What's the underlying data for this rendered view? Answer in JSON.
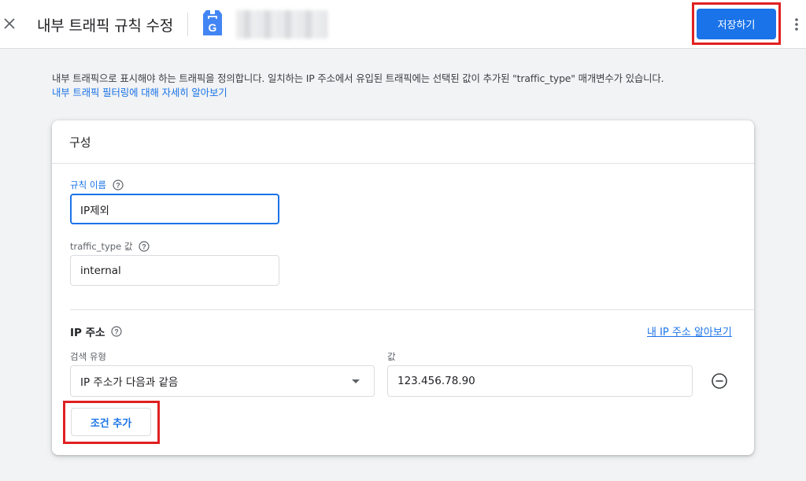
{
  "header": {
    "title": "내부 트래픽 규칙 수정",
    "property_name_obscured": "",
    "save_label": "저장하기"
  },
  "description": {
    "text": "내부 트래픽으로 표시해야 하는 트래픽을 정의합니다. 일치하는 IP 주소에서 유입된 트래픽에는 선택된 값이 추가된 \"traffic_type\" 매개변수가 있습니다.",
    "link": "내부 트래픽 필터링에 대해 자세히 알아보기"
  },
  "config": {
    "title": "구성",
    "rule_name": {
      "label": "규칙 이름",
      "value": "IP제외"
    },
    "traffic_type": {
      "label": "traffic_type 값",
      "value": "internal"
    },
    "ip": {
      "title": "IP 주소",
      "find_ip_link": "내 IP 주소 알아보기",
      "match_type_label": "검색 유형",
      "match_type_value": "IP 주소가 다음과 같음",
      "value_label": "값",
      "value": "123.456.78.90",
      "add_condition_label": "조건 추가"
    }
  },
  "colors": {
    "accent": "#1a73e8",
    "highlight": "#e02020"
  },
  "icons": [
    "close-icon",
    "google-tag-icon",
    "more-vert-icon",
    "help-icon",
    "dropdown-caret-icon",
    "remove-circle-icon"
  ]
}
